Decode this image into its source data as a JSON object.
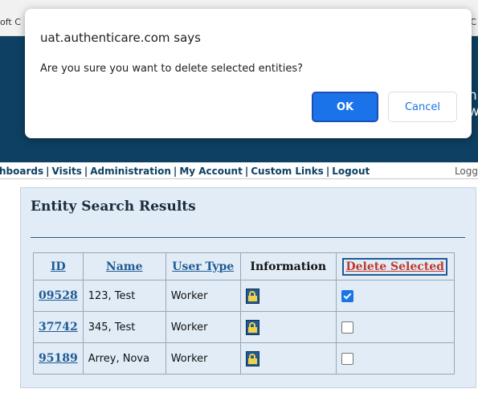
{
  "browser": {
    "left_fragment": "oft C",
    "right_fragment": "C"
  },
  "header": {
    "right_fragment_1": "h",
    "right_fragment_2": "w"
  },
  "nav": {
    "items": [
      "hboards",
      "Visits",
      "Administration",
      "My Account",
      "Custom Links",
      "Logout"
    ],
    "separator": "|",
    "login_fragment": "Logg"
  },
  "panel": {
    "title": "Entity Search Results"
  },
  "table": {
    "headers": {
      "id": "ID",
      "name": "Name",
      "user_type": "User Type",
      "information": "Information",
      "delete": "Delete Selected"
    },
    "rows": [
      {
        "id": "09528",
        "name": "123, Test",
        "user_type": "Worker",
        "info_icon": "lock-icon",
        "selected": true
      },
      {
        "id": "37742",
        "name": "345, Test",
        "user_type": "Worker",
        "info_icon": "lock-icon",
        "selected": false
      },
      {
        "id": "95189",
        "name": "Arrey, Nova",
        "user_type": "Worker",
        "info_icon": "lock-icon",
        "selected": false
      }
    ]
  },
  "dialog": {
    "title": "uat.authenticare.com says",
    "message": "Are you sure you want to delete selected entities?",
    "ok_label": "OK",
    "cancel_label": "Cancel"
  },
  "colors": {
    "header_bg": "#0d4062",
    "ok_button": "#1a73e8",
    "delete_header": "#c0392b",
    "link": "#1f5b94"
  }
}
